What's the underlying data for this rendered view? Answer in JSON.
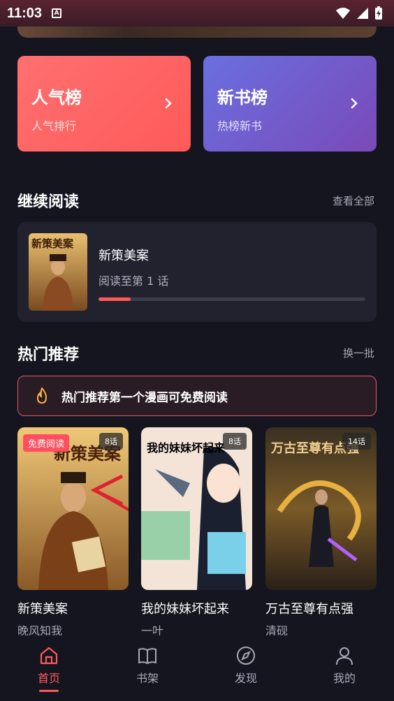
{
  "status_bar": {
    "time": "11:03",
    "notification_icon": "A"
  },
  "rank_cards": [
    {
      "title": "人气榜",
      "subtitle": "人气排行"
    },
    {
      "title": "新书榜",
      "subtitle": "热榜新书"
    }
  ],
  "continue_reading": {
    "section_title": "继续阅读",
    "view_all": "查看全部",
    "book_name": "新策美案",
    "cover_title": "新策美案",
    "progress_text": "阅读至第 1 话",
    "progress": 0.12
  },
  "hot": {
    "section_title": "热门推荐",
    "refresh": "换一批",
    "notice": "热门推荐第一个漫画可免费阅读",
    "books": [
      {
        "title": "新策美案",
        "author": "晚风知我",
        "episodes": "8话",
        "free_badge": "免费阅读",
        "cover_title": "新策美案"
      },
      {
        "title": "我的妹妹坏起来",
        "author": "一叶",
        "episodes": "8话",
        "cover_title": "我的妹妹坏起来"
      },
      {
        "title": "万古至尊有点强",
        "author": "清砚",
        "episodes": "14话",
        "cover_title": "万古至尊有点强"
      }
    ]
  },
  "tabs": [
    {
      "label": "首页",
      "icon": "home-icon",
      "active": true
    },
    {
      "label": "书架",
      "icon": "book-icon",
      "active": false
    },
    {
      "label": "发现",
      "icon": "compass-icon",
      "active": false
    },
    {
      "label": "我的",
      "icon": "user-icon",
      "active": false
    }
  ],
  "colors": {
    "accent": "#ff5a5a",
    "background": "#151520",
    "card": "#22222f"
  }
}
